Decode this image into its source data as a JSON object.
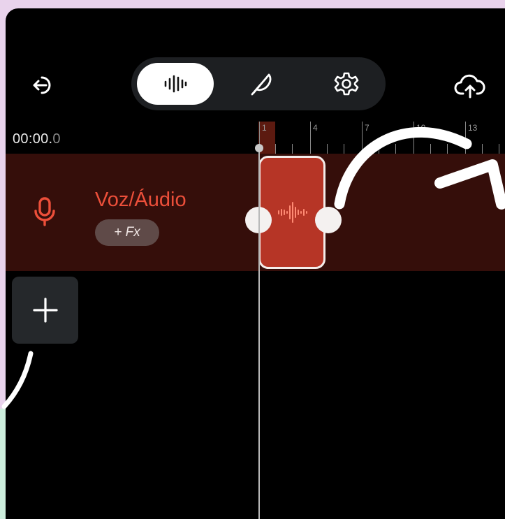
{
  "toolbar": {
    "back_icon": "exit-arrow-icon",
    "tabs": [
      {
        "icon": "waveform-icon",
        "active": true
      },
      {
        "icon": "feather-icon",
        "active": false
      },
      {
        "icon": "gear-icon",
        "active": false
      }
    ],
    "upload_icon": "cloud-upload-icon"
  },
  "timeline": {
    "time_main": "00:00.",
    "time_frac": "0",
    "ruler_labels": [
      "1",
      "4",
      "7",
      "10",
      "13"
    ]
  },
  "track": {
    "icon": "microphone-icon",
    "name": "Voz/Áudio",
    "fx_label": "+ Fx"
  },
  "add_track_icon": "plus-icon",
  "colors": {
    "accent": "#ec4f3a",
    "track_bg": "#350e0a",
    "clip": "#b63526",
    "page_bg": "#e9d3ec"
  }
}
